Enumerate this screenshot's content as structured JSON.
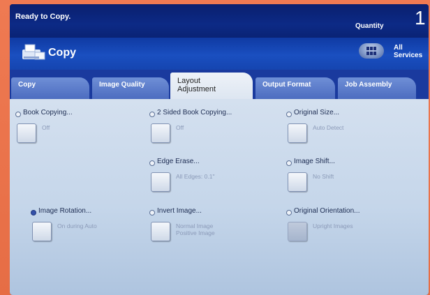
{
  "status": {
    "message": "Ready to Copy.",
    "quantity_label": "Quantity",
    "quantity_value": "1"
  },
  "app": {
    "title": "Copy",
    "all_services_line1": "All",
    "all_services_line2": "Services"
  },
  "tabs": [
    {
      "label": "Copy"
    },
    {
      "label": "Image Quality"
    },
    {
      "label_line1": "Layout",
      "label_line2": "Adjustment",
      "active": true
    },
    {
      "label": "Output Format"
    },
    {
      "label": "Job Assembly"
    }
  ],
  "features": {
    "book_copying": {
      "label": "Book Copying...",
      "value": "Off"
    },
    "two_sided_book_copying": {
      "label": "2 Sided Book Copying...",
      "value": "Off"
    },
    "original_size": {
      "label": "Original Size...",
      "value": "Auto Detect"
    },
    "edge_erase": {
      "label": "Edge Erase...",
      "value": "All Edges: 0.1\""
    },
    "image_shift": {
      "label": "Image Shift...",
      "value": "No Shift"
    },
    "image_rotation": {
      "label": "Image Rotation...",
      "value": "On during Auto",
      "selected": true
    },
    "invert_image": {
      "label": "Invert Image...",
      "value_line1": "Normal Image",
      "value_line2": "Positive Image"
    },
    "original_orientation": {
      "label": "Original Orientation...",
      "value": "Upright Images"
    }
  },
  "colors": {
    "bezel": "#e8734c",
    "status_bar": "#0c2a86",
    "app_bar": "#1a4fc0",
    "tab_inactive": "#5a7bcb",
    "panel": "#c9d8ec"
  },
  "icons": {
    "app": "copy-machine-icon",
    "services": "grid-icon"
  }
}
